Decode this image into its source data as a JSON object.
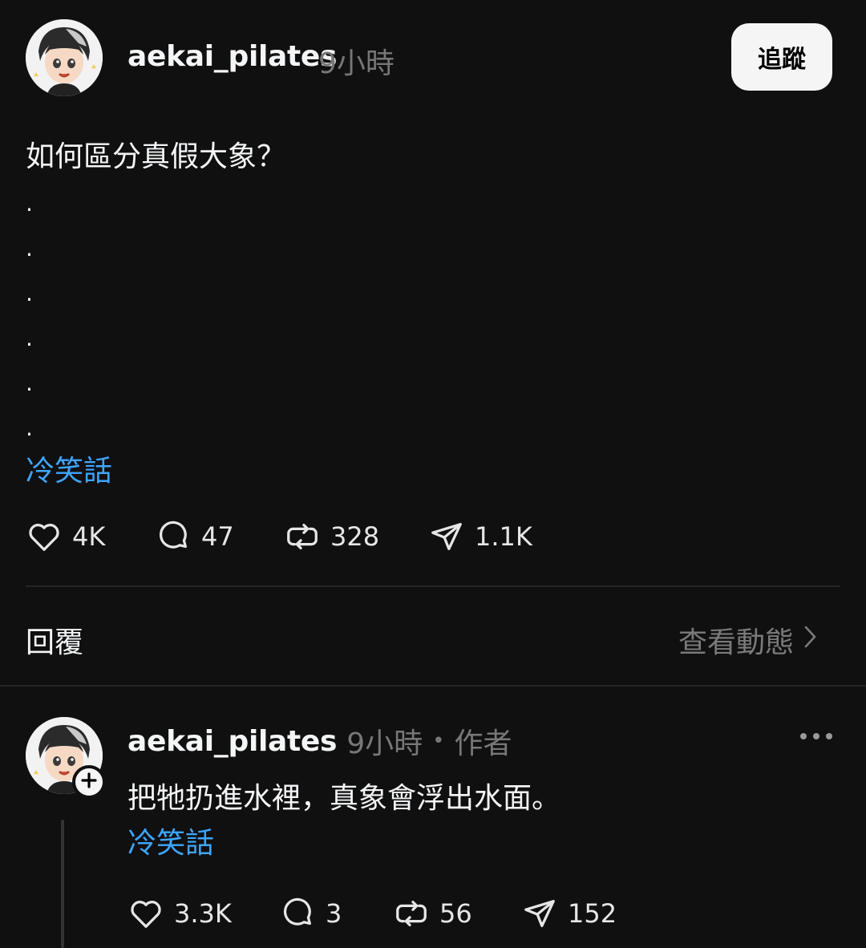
{
  "post": {
    "username": "aekai_pilates",
    "time": "9小時",
    "follow_label": "追蹤",
    "text": "如何區分真假大象？",
    "dots": [
      ".",
      ".",
      ".",
      ".",
      ".",
      "."
    ],
    "tag": "冷笑話",
    "stats": {
      "likes": "4K",
      "comments": "47",
      "reposts": "328",
      "shares": "1.1K"
    }
  },
  "section": {
    "replies_label": "回覆",
    "activity_label": "查看動態"
  },
  "reply": {
    "username": "aekai_pilates",
    "time": "9小時",
    "separator": "•",
    "role": "作者",
    "text": "把牠扔進水裡，真象會浮出水面。",
    "tag": "冷笑話",
    "stats": {
      "likes": "3.3K",
      "comments": "3",
      "reposts": "56",
      "shares": "152"
    }
  },
  "colors": {
    "background": "#101010",
    "tag_blue": "#3ea6ff",
    "muted": "#777777"
  },
  "icons": [
    "heart-icon",
    "comment-icon",
    "repost-icon",
    "share-icon",
    "chevron-right-icon",
    "more-icon",
    "plus-icon"
  ]
}
